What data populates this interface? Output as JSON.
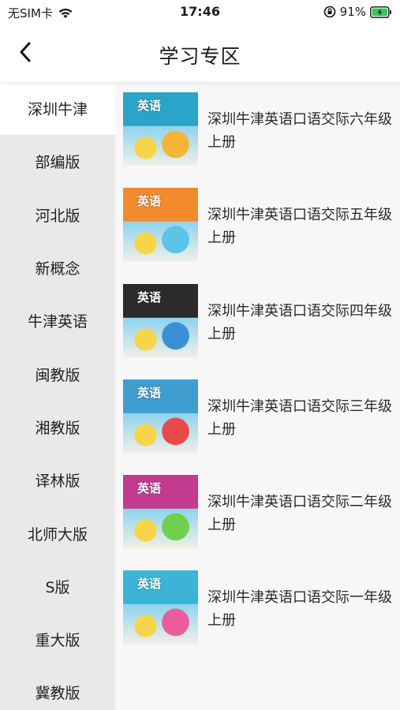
{
  "status": {
    "carrier": "无SIM卡",
    "time": "17:46",
    "battery": "91%"
  },
  "nav": {
    "title": "学习专区"
  },
  "sidebar": {
    "items": [
      {
        "label": "深圳牛津"
      },
      {
        "label": "部编版"
      },
      {
        "label": "河北版"
      },
      {
        "label": "新概念"
      },
      {
        "label": "牛津英语"
      },
      {
        "label": "闽教版"
      },
      {
        "label": "湘教版"
      },
      {
        "label": "译林版"
      },
      {
        "label": "北师大版"
      },
      {
        "label": "S版"
      },
      {
        "label": "重大版"
      },
      {
        "label": "冀教版"
      }
    ]
  },
  "books": [
    {
      "name": "深圳牛津英语口语交际六年级上册",
      "cover_text": "英语",
      "colors": [
        "#2aa4c8",
        "#f2b53a"
      ]
    },
    {
      "name": "深圳牛津英语口语交际五年级上册",
      "cover_text": "英语",
      "colors": [
        "#f28a2e",
        "#5bc4e8"
      ]
    },
    {
      "name": "深圳牛津英语口语交际四年级上册",
      "cover_text": "英语",
      "colors": [
        "#2b2b2b",
        "#3b8fd6"
      ]
    },
    {
      "name": "深圳牛津英语口语交际三年级上册",
      "cover_text": "英语",
      "colors": [
        "#3f9ecf",
        "#e84a4a"
      ]
    },
    {
      "name": "深圳牛津英语口语交际二年级上册",
      "cover_text": "英语",
      "colors": [
        "#c23b8f",
        "#6fcf4f"
      ]
    },
    {
      "name": "深圳牛津英语口语交际一年级上册",
      "cover_text": "英语",
      "colors": [
        "#3bb4d6",
        "#e95d9a"
      ]
    }
  ],
  "icons": {
    "back": "chevron-left-icon",
    "wifi": "wifi-icon",
    "lock": "orientation-lock-icon",
    "battery": "battery-charging-icon"
  },
  "colors": {
    "sidebar_bg": "#e9e9e9",
    "content_bg": "#f7f7f7",
    "battery_green": "#34c759"
  }
}
